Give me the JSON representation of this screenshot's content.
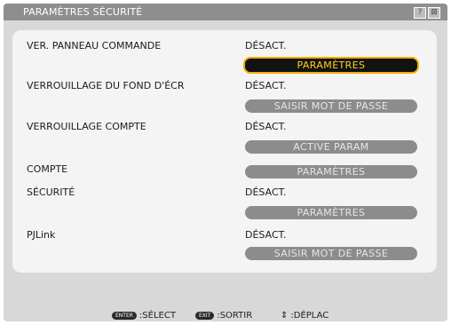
{
  "window": {
    "title": "PARAMÈTRES SÉCURITÉ",
    "help_label": "?",
    "close_label": "⊠"
  },
  "rows": [
    {
      "label": "VER. PANNEAU COMMANDE",
      "value": "DÉSACT.",
      "button": "PARAMÈTRES",
      "button_active": true
    },
    {
      "label": "VERROUILLAGE DU FOND D'ÉCR",
      "value": "DÉSACT.",
      "button": "SAISIR MOT DE PASSE",
      "button_active": false
    },
    {
      "label": "VERROUILLAGE COMPTE",
      "value": "DÉSACT.",
      "button": "ACTIVE PARAM",
      "button_active": false
    },
    {
      "label": "COMPTE",
      "value": "",
      "button": "PARAMÈTRES",
      "button_active": false
    },
    {
      "label": "SÉCURITÉ",
      "value": "DÉSACT.",
      "button": "PARAMÈTRES",
      "button_active": false
    },
    {
      "label": "PJLink",
      "value": "DÉSACT.",
      "button": "SAISIR MOT DE PASSE",
      "button_active": false
    }
  ],
  "footer": {
    "enter_key": "ENTER",
    "enter_label": ":SÉLECT",
    "exit_key": "EXIT",
    "exit_label": ":SORTIR",
    "move_icon": "updown-arrow-icon",
    "move_glyph": "⇕",
    "move_label": ":DÉPLAC"
  },
  "colors": {
    "title_bar": "#8e8e8e",
    "active_button_bg": "#121212",
    "active_button_text": "#ffd21a",
    "active_button_border": "#f0b000",
    "inactive_button_bg": "#8c8c8c"
  }
}
